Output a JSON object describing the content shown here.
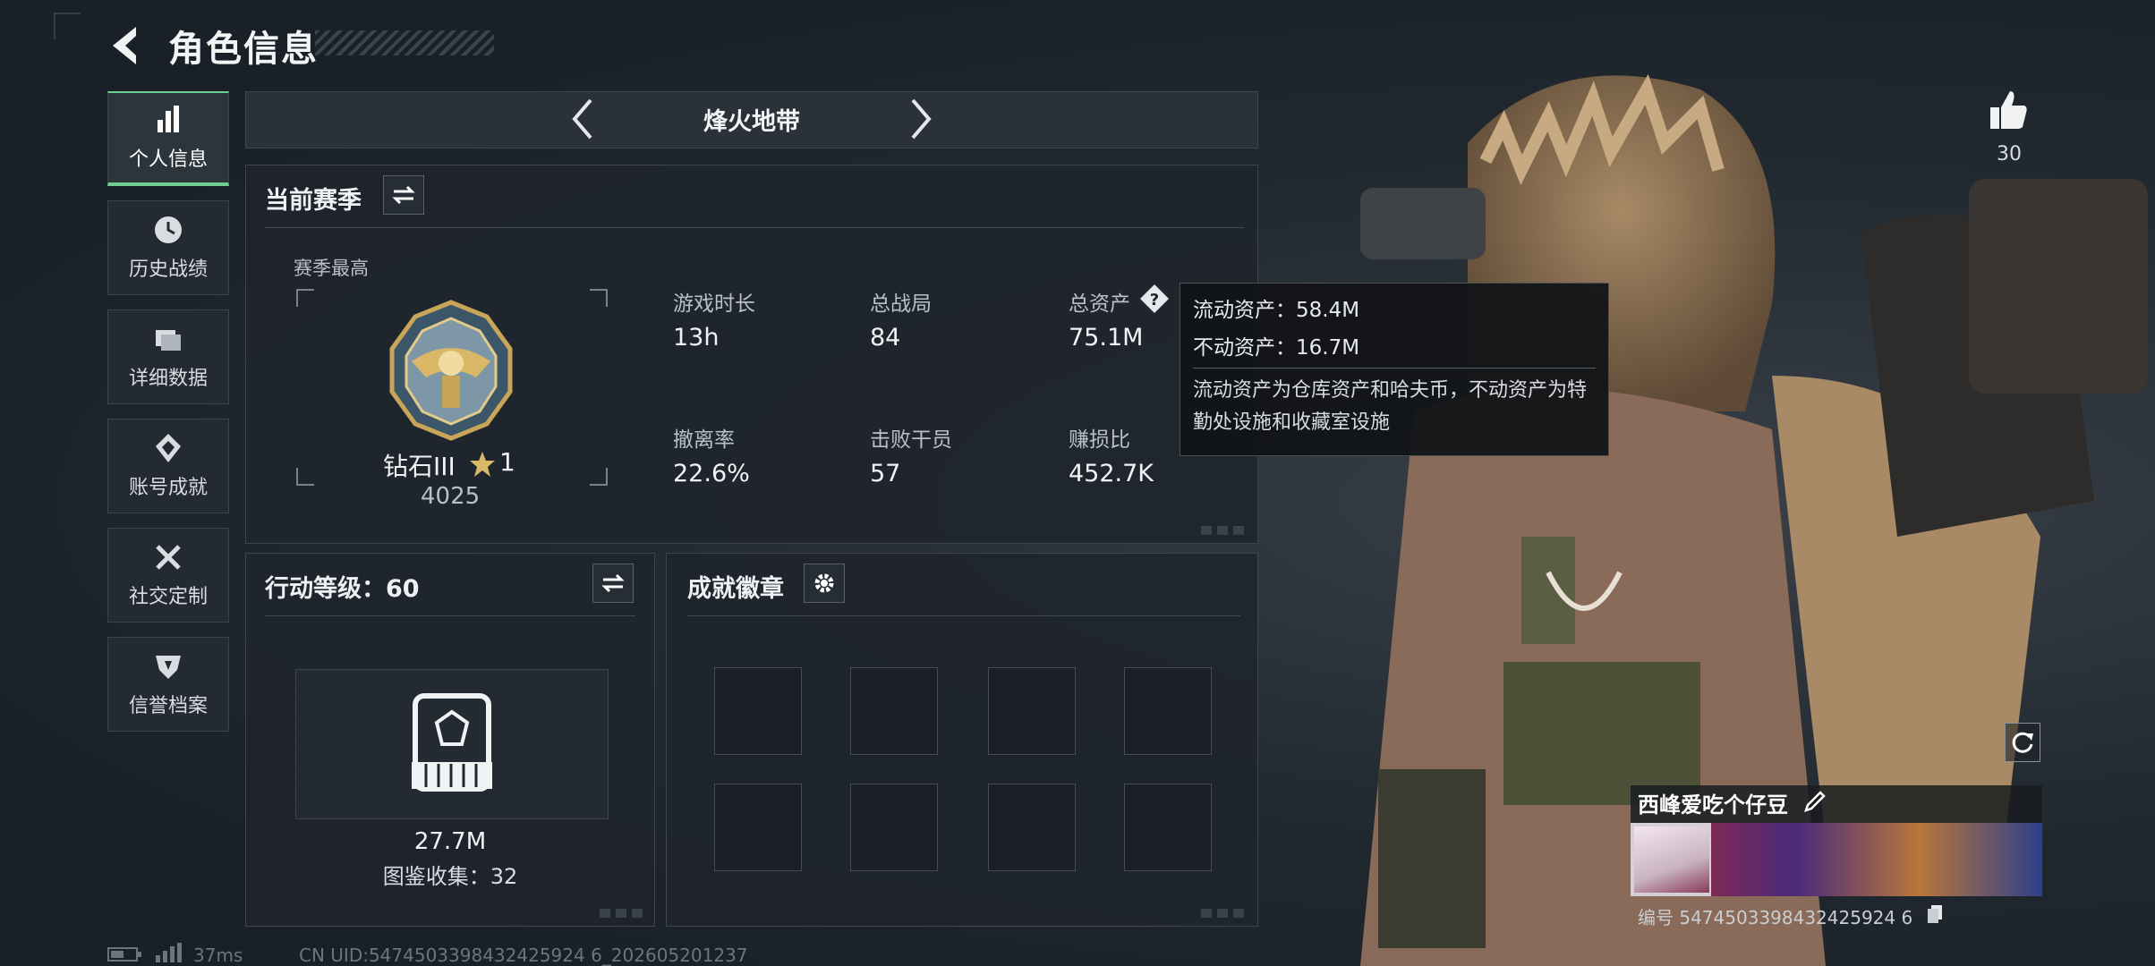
{
  "header": {
    "title": "角色信息"
  },
  "sidebar": {
    "items": [
      {
        "label": "个人信息",
        "icon": "bar-chart-icon",
        "active": true
      },
      {
        "label": "历史战绩",
        "icon": "clock-icon"
      },
      {
        "label": "详细数据",
        "icon": "folder-icon"
      },
      {
        "label": "账号成就",
        "icon": "achievement-icon"
      },
      {
        "label": "社交定制",
        "icon": "tools-icon"
      },
      {
        "label": "信誉档案",
        "icon": "shield-icon"
      }
    ]
  },
  "mode": {
    "label": "烽火地带"
  },
  "season": {
    "title": "当前赛季",
    "best_label": "赛季最高",
    "rank_name": "钻石III",
    "rank_stars": "1",
    "rank_points": "4025",
    "stats": [
      {
        "label": "游戏时长",
        "value": "13h"
      },
      {
        "label": "总战局",
        "value": "84"
      },
      {
        "label": "总资产",
        "value": "75.1M"
      },
      {
        "label": "撤离率",
        "value": "22.6%"
      },
      {
        "label": "击败干员",
        "value": "57"
      },
      {
        "label": "赚损比",
        "value": "452.7K"
      }
    ]
  },
  "tooltip": {
    "liquid": "流动资产：58.4M",
    "fixed": "不动资产：16.7M",
    "desc": "流动资产为仓库资产和哈夫币，不动资产为特勤处设施和收藏室设施"
  },
  "action_level": {
    "title": "行动等级：60",
    "value": "27.7M",
    "collection": "图鉴收集：32"
  },
  "achievements": {
    "title": "成就徽章",
    "slots": 8
  },
  "status_bar": {
    "ping": "37ms",
    "uid": "CN UID:5474503398432425924 6_202605201237"
  },
  "player": {
    "likes": "30",
    "name": "西峰爱吃个仔豆",
    "id": "编号 5474503398432425924 6"
  },
  "colors": {
    "accent": "#6ecf92",
    "panel": "#1f252c",
    "tooltip": "#121417"
  }
}
